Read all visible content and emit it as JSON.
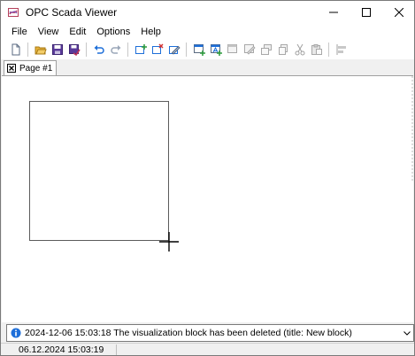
{
  "window": {
    "title": "OPC Scada Viewer",
    "minimize_icon": "minimize-icon",
    "maximize_icon": "maximize-icon",
    "close_icon": "close-icon"
  },
  "menu": {
    "items": [
      "File",
      "View",
      "Edit",
      "Options",
      "Help"
    ]
  },
  "toolbar": {
    "buttons": [
      {
        "icon": "new-document-icon"
      },
      {
        "icon": "open-folder-icon"
      },
      {
        "icon": "save-icon"
      },
      {
        "icon": "save-all-icon"
      },
      {
        "icon": "undo-icon"
      },
      {
        "icon": "redo-icon"
      },
      {
        "icon": "add-page-icon"
      },
      {
        "icon": "delete-page-icon"
      },
      {
        "icon": "edit-page-icon"
      },
      {
        "icon": "add-block-icon"
      },
      {
        "icon": "add-text-block-icon"
      },
      {
        "icon": "delete-block-icon"
      },
      {
        "icon": "edit-block-icon"
      },
      {
        "icon": "bring-front-icon"
      },
      {
        "icon": "copy-icon"
      },
      {
        "icon": "cut-icon"
      },
      {
        "icon": "paste-icon"
      },
      {
        "icon": "align-icon"
      }
    ]
  },
  "tabs": [
    {
      "label": "Page #1",
      "active": true
    }
  ],
  "log": {
    "message": "2024-12-06 15:03:18 The visualization block has been deleted (title: New block)",
    "icon": "info-icon"
  },
  "status": {
    "datetime": "06.12.2024 15:03:19"
  },
  "colors": {
    "accent_blue": "#1e6fd9",
    "folder_yellow": "#e8b23a",
    "save_purple": "#5a3a9a",
    "block_border": "#5c5c5c"
  }
}
